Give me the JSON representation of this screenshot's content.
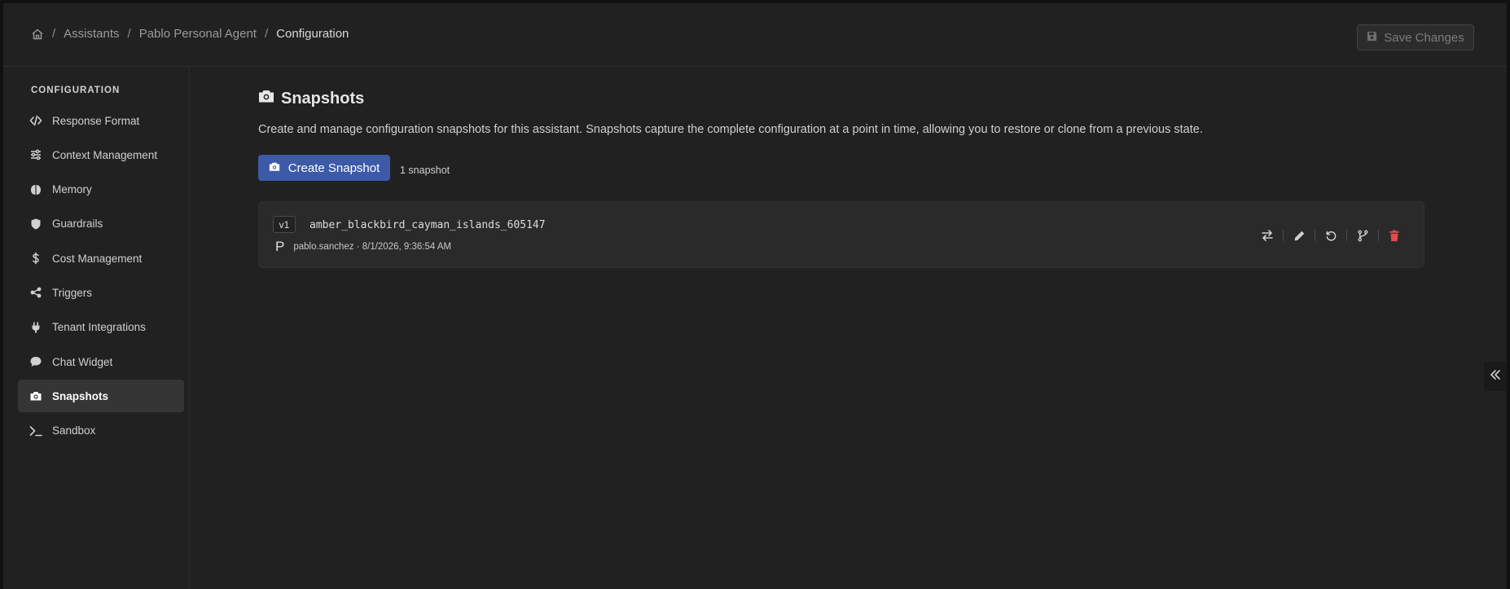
{
  "breadcrumb": {
    "items": [
      "Assistants",
      "Pablo Personal Agent"
    ],
    "current": "Configuration",
    "separator": "/"
  },
  "header": {
    "save_label": "Save Changes"
  },
  "sidebar": {
    "title": "CONFIGURATION",
    "items": [
      {
        "label": "Response Format",
        "icon": "code-icon"
      },
      {
        "label": "Context Management",
        "icon": "sliders-icon"
      },
      {
        "label": "Memory",
        "icon": "brain-icon"
      },
      {
        "label": "Guardrails",
        "icon": "shield-icon"
      },
      {
        "label": "Cost Management",
        "icon": "dollar-icon"
      },
      {
        "label": "Triggers",
        "icon": "share-icon"
      },
      {
        "label": "Tenant Integrations",
        "icon": "plug-icon"
      },
      {
        "label": "Chat Widget",
        "icon": "chat-icon"
      },
      {
        "label": "Snapshots",
        "icon": "camera-icon",
        "active": true
      },
      {
        "label": "Sandbox",
        "icon": "terminal-icon"
      }
    ]
  },
  "main": {
    "title": "Snapshots",
    "description": "Create and manage configuration snapshots for this assistant. Snapshots capture the complete configuration at a point in time, allowing you to restore or clone from a previous state.",
    "create_label": "Create Snapshot",
    "count_label": "1 snapshot"
  },
  "snapshots": [
    {
      "version": "v1",
      "name": "amber_blackbird_cayman_islands_605147",
      "avatar": "P",
      "meta": "pablo.sanchez · 8/1/2026, 9:36:54 AM"
    }
  ],
  "colors": {
    "background": "#212121",
    "accent": "#3d5aa8",
    "active_item": "#353535",
    "danger": "#e5484d"
  }
}
